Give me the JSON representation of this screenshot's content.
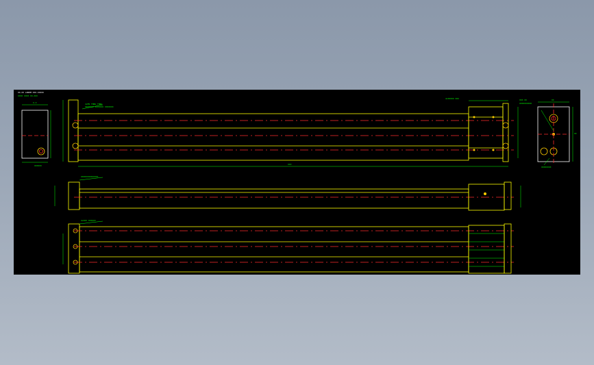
{
  "drawing": {
    "background": "#000000",
    "colors": {
      "outline": "#ffff00",
      "centerline": "#ff2a2a",
      "dimension": "#00ff00",
      "text": "#ffffff",
      "hole": "#ffcc00"
    },
    "title_block": [
      "XX-XX LOREM XXX-XXXXX",
      "XXXX XXXX XX-XXX"
    ],
    "dimension_labels": {
      "overall_length": "XXX",
      "left_view_top": "X.X",
      "right_view_top": "XX",
      "right_view_side": "XX"
    },
    "notes": {
      "front_port": "4×M5 THRU THRU",
      "front_port_line2": "XXXXXXX XXXXXXX XXXXXXX",
      "end_port": "4×XXXXX XXX",
      "side_port": "XXXXXXXXXXXXXX",
      "bottom_port": "4×XXX XXXXXX",
      "right_note": "XXX XX",
      "right_note2": "XXXXXXXXXX",
      "left_note": "XXXXXX",
      "right_bottom_note": "XXXXXXXX"
    }
  }
}
